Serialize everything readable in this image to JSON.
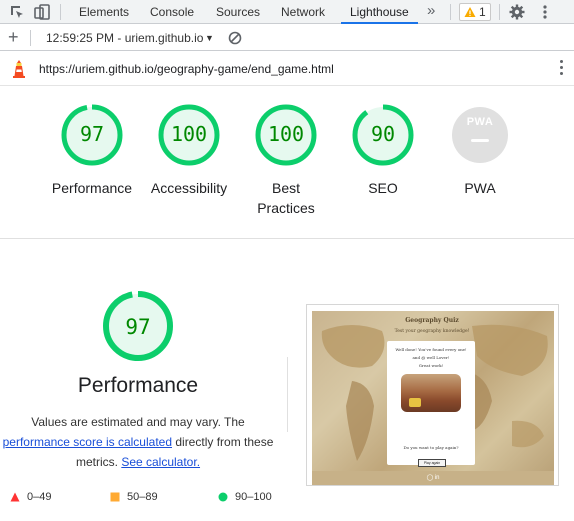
{
  "devtools": {
    "tabs": [
      "Elements",
      "Console",
      "Sources",
      "Network",
      "Lighthouse"
    ],
    "active_tab": "Lighthouse",
    "more_tabs_glyph": "»",
    "warning_count": "1",
    "icons": [
      "inspect-element-icon",
      "device-toolbar-icon",
      "warning-icon",
      "settings-gear-icon",
      "more-options-icon"
    ]
  },
  "lighthouse_toolbar": {
    "new_report_glyph": "+",
    "report_selector": "12:59:25 PM - uriem.github.io",
    "icons": [
      "add-report-icon",
      "dropdown-caret-icon",
      "clear-all-icon"
    ]
  },
  "url_row": {
    "url": "https://uriem.github.io/geography-game/end_game.html",
    "icons": [
      "lighthouse-logo-icon",
      "more-options-icon"
    ]
  },
  "scores": [
    {
      "label": "Performance",
      "value": "97",
      "status": "pass"
    },
    {
      "label": "Accessibility",
      "value": "100",
      "status": "pass"
    },
    {
      "label": "Best Practices",
      "value": "100",
      "status": "pass"
    },
    {
      "label": "SEO",
      "value": "90",
      "status": "pass"
    },
    {
      "label": "PWA",
      "value": "PWA",
      "status": "na"
    }
  ],
  "performance": {
    "score": "97",
    "title": "Performance",
    "desc_part1": "Values are estimated and may vary. The",
    "link1": "performance score is calculated",
    "desc_part2": " directly from these",
    "desc_part3": "metrics. ",
    "link2": "See calculator."
  },
  "legend": [
    {
      "range": "0–49",
      "shape": "triangle",
      "color": "#ff3333"
    },
    {
      "range": "50–89",
      "shape": "square",
      "color": "#ffaa33"
    },
    {
      "range": "90–100",
      "shape": "circle",
      "color": "#0cce6b"
    }
  ],
  "screenshot": {
    "title": "Geography Quiz",
    "subtitle": "Test your geography knowledge!",
    "line1": "Well done! You've found every one!",
    "line2": "and @ well Lover!",
    "line3": "Great work!",
    "button": "Play again",
    "question": "Do you want to play again?"
  },
  "colors": {
    "pass": "#0cce6b",
    "pass_fill": "#e6f9ef",
    "pass_text": "#008800",
    "na": "#e0e0e0",
    "link": "#1a4fd8",
    "active_tab_underline": "#1a73e8"
  }
}
